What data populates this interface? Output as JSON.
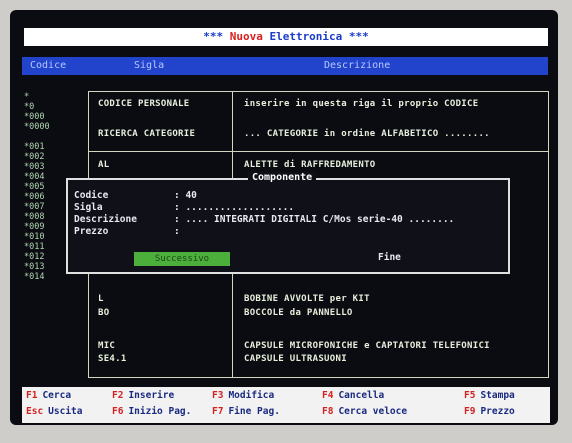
{
  "app_title": {
    "prefix": "*** ",
    "first": "Nuova",
    "rest": " Elettronica ***"
  },
  "columns": {
    "codice": "Codice",
    "sigla": "Sigla",
    "descrizione": "Descrizione"
  },
  "codes": [
    "*",
    "*0",
    "*000",
    "*0000",
    "*001",
    "*002",
    "*003",
    "*004",
    "*005",
    "*006",
    "*007",
    "*008",
    "*009",
    "*010",
    "*011",
    "*012",
    "*013",
    "*014"
  ],
  "rows": [
    {
      "sigla": "CODICE PERSONALE",
      "descrizione": "inserire in questa riga il proprio CODICE"
    },
    {
      "sigla": "RICERCA CATEGORIE",
      "descrizione": "... CATEGORIE in ordine ALFABETICO ........"
    },
    {
      "sigla": "AL",
      "descrizione": "ALETTE di RAFFREDAMENTO"
    },
    {
      "sigla": "L",
      "descrizione": "BOBINE AVVOLTE per KIT"
    },
    {
      "sigla": "BO",
      "descrizione": "BOCCOLE da PANNELLO"
    },
    {
      "sigla": "MIC",
      "descrizione": "CAPSULE MICROFONICHE e CAPTATORI TELEFONICI"
    },
    {
      "sigla": "SE4.1",
      "descrizione": "CAPSULE ULTRASUONI"
    }
  ],
  "dialog": {
    "title": "Componente",
    "fields": [
      {
        "label": "Codice",
        "value": ": 40"
      },
      {
        "label": "Sigla",
        "value": ": ..................."
      },
      {
        "label": "Descrizione",
        "value": ": .... INTEGRATI DIGITALI C/Mos serie-40 ........"
      },
      {
        "label": "Prezzo",
        "value": ":"
      }
    ],
    "primary_button": "Successivo ",
    "fine": "Fine"
  },
  "fkeys": [
    {
      "key": "F1",
      "label": "Cerca"
    },
    {
      "key": "F2",
      "label": "Inserire"
    },
    {
      "key": "F3",
      "label": "Modifica"
    },
    {
      "key": "F4",
      "label": "Cancella"
    },
    {
      "key": "F5",
      "label": "Stampa"
    },
    {
      "key": "Esc",
      "label": "Uscita"
    },
    {
      "key": "F6",
      "label": "Inizio Pag."
    },
    {
      "key": "F7",
      "label": "Fine Pag."
    },
    {
      "key": "F8",
      "label": "Cerca veloce"
    },
    {
      "key": "F9",
      "label": "Prezzo"
    }
  ],
  "colors": {
    "title_bg": "#ffffff",
    "header_bg": "#2244cc",
    "screen_bg": "#0b0b12",
    "accent_green": "#4caf3c",
    "fkey_red": "#d42020"
  }
}
